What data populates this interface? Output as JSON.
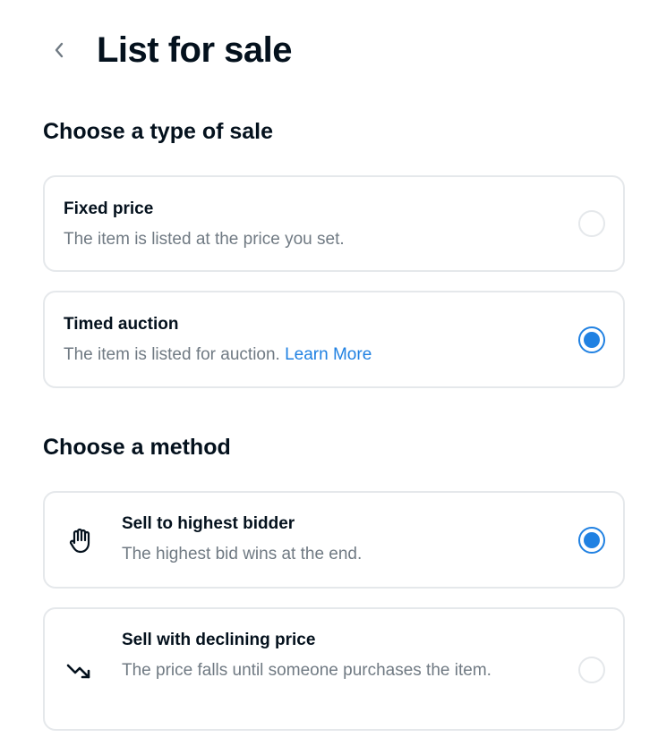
{
  "header": {
    "title": "List for sale",
    "back_icon": "chevron-left-icon"
  },
  "sale_type": {
    "title": "Choose a type of sale",
    "options": [
      {
        "label": "Fixed price",
        "description": "The item is listed at the price you set.",
        "selected": false
      },
      {
        "label": "Timed auction",
        "description": "The item is listed for auction.",
        "link_text": "Learn More",
        "selected": true
      }
    ]
  },
  "method": {
    "title": "Choose a method",
    "options": [
      {
        "label": "Sell to highest bidder",
        "description": "The highest bid wins at the end.",
        "icon": "raised-hand-icon",
        "selected": true
      },
      {
        "label": "Sell with declining price",
        "description": "The price falls until someone purchases the item.",
        "icon": "trending-down-icon",
        "selected": false
      }
    ]
  },
  "colors": {
    "accent": "#2081e2",
    "text": "#04111d",
    "muted": "#707a83",
    "border": "#e5e8eb"
  }
}
